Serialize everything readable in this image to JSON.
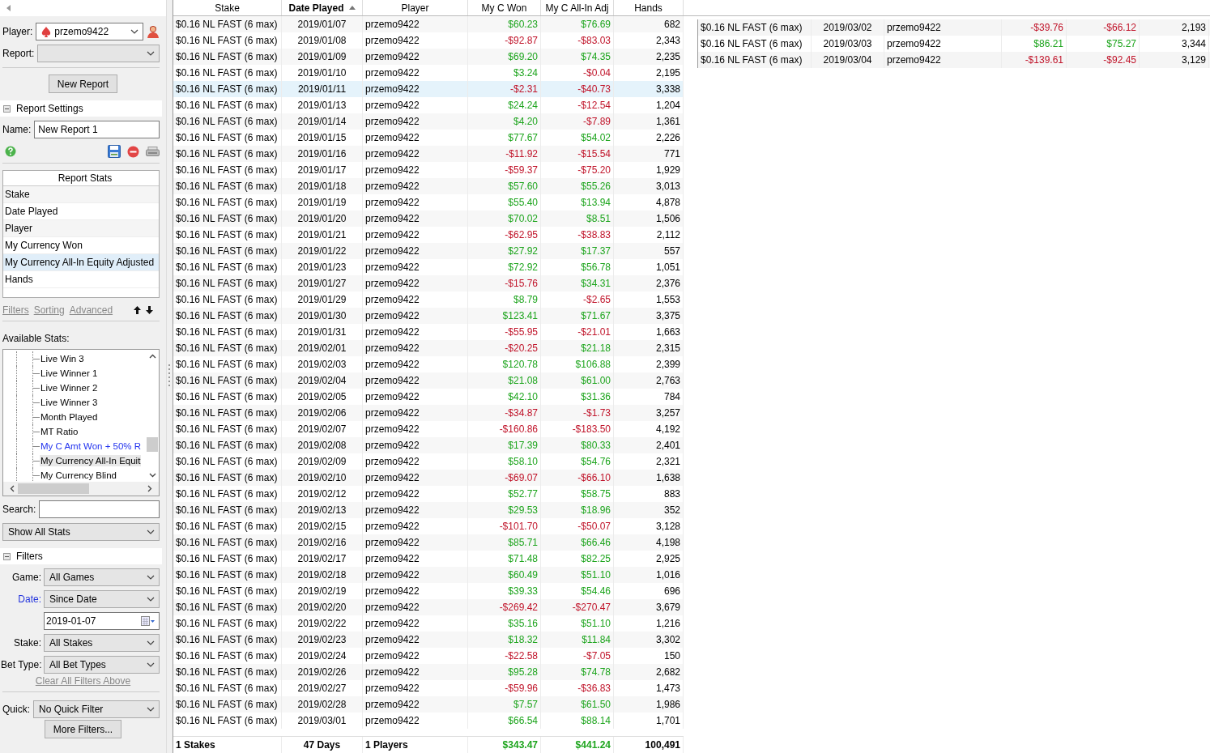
{
  "sidebar": {
    "player": {
      "label": "Player:",
      "value": "przemo9422"
    },
    "report": {
      "label": "Report:"
    },
    "new_report_button": "New Report",
    "report_settings": {
      "title": "Report Settings",
      "expanded": true,
      "name_label": "Name:",
      "name_value": "New Report 1"
    },
    "report_stats": {
      "header": "Report Stats",
      "items": [
        {
          "label": "Stake",
          "selected": false
        },
        {
          "label": "Date Played",
          "selected": false
        },
        {
          "label": "Player",
          "selected": false
        },
        {
          "label": "My Currency Won",
          "selected": false
        },
        {
          "label": "My Currency All-In Equity Adjusted",
          "selected": true
        },
        {
          "label": "Hands",
          "selected": false
        }
      ]
    },
    "links": [
      "Filters",
      "Sorting",
      "Advanced"
    ],
    "available_stats": {
      "label": "Available Stats:",
      "items": [
        {
          "label": "Live Win 3",
          "custom": false,
          "selected": false
        },
        {
          "label": "Live Winner 1",
          "custom": false,
          "selected": false
        },
        {
          "label": "Live Winner 2",
          "custom": false,
          "selected": false
        },
        {
          "label": "Live Winner 3",
          "custom": false,
          "selected": false
        },
        {
          "label": "Month Played",
          "custom": false,
          "selected": false
        },
        {
          "label": "MT Ratio",
          "custom": false,
          "selected": false
        },
        {
          "label": "My C Amt Won + 50% R",
          "custom": true,
          "selected": false
        },
        {
          "label": "My Currency All-In Equit",
          "custom": false,
          "selected": true
        },
        {
          "label": "My Currency Blind",
          "custom": false,
          "selected": false
        }
      ]
    },
    "search": {
      "label": "Search:"
    },
    "stat_filter": "Show All Stats",
    "filters": {
      "title": "Filters",
      "expanded": true,
      "fields": [
        {
          "kind": "select",
          "label": "Game:",
          "value": "All Games",
          "active": false
        },
        {
          "kind": "select",
          "label": "Date:",
          "value": "Since Date",
          "active": true
        },
        {
          "kind": "date",
          "value": "2019-01-07"
        },
        {
          "kind": "select",
          "label": "Stake:",
          "value": "All Stakes",
          "active": false
        },
        {
          "kind": "select",
          "label": "Bet Type:",
          "value": "All Bet Types",
          "active": false
        }
      ],
      "clear_link": "Clear All Filters Above",
      "quick": {
        "label": "Quick:",
        "value": "No Quick Filter"
      },
      "more_button": "More Filters..."
    }
  },
  "table": {
    "columns": [
      {
        "label": "Stake",
        "sorted": false
      },
      {
        "label": "Date Played",
        "sorted": true
      },
      {
        "label": "Player",
        "sorted": false
      },
      {
        "label": "My C Won",
        "sorted": false
      },
      {
        "label": "My C All-In Adj",
        "sorted": false
      },
      {
        "label": "Hands",
        "sorted": false
      }
    ],
    "rows": [
      {
        "stake": "$0.16 NL FAST (6 max)",
        "date": "2019/01/07",
        "player": "przemo9422",
        "won": "$60.23",
        "won_neg": false,
        "adj": "$76.69",
        "adj_neg": false,
        "hands": "682",
        "selected": false
      },
      {
        "stake": "$0.16 NL FAST (6 max)",
        "date": "2019/01/08",
        "player": "przemo9422",
        "won": "-$92.87",
        "won_neg": true,
        "adj": "-$83.03",
        "adj_neg": true,
        "hands": "2,343",
        "selected": false
      },
      {
        "stake": "$0.16 NL FAST (6 max)",
        "date": "2019/01/09",
        "player": "przemo9422",
        "won": "$69.20",
        "won_neg": false,
        "adj": "$74.35",
        "adj_neg": false,
        "hands": "2,235",
        "selected": false
      },
      {
        "stake": "$0.16 NL FAST (6 max)",
        "date": "2019/01/10",
        "player": "przemo9422",
        "won": "$3.24",
        "won_neg": false,
        "adj": "-$0.04",
        "adj_neg": true,
        "hands": "2,195",
        "selected": false
      },
      {
        "stake": "$0.16 NL FAST (6 max)",
        "date": "2019/01/11",
        "player": "przemo9422",
        "won": "-$2.31",
        "won_neg": true,
        "adj": "-$40.73",
        "adj_neg": true,
        "hands": "3,338",
        "selected": true
      },
      {
        "stake": "$0.16 NL FAST (6 max)",
        "date": "2019/01/13",
        "player": "przemo9422",
        "won": "$24.24",
        "won_neg": false,
        "adj": "-$12.54",
        "adj_neg": true,
        "hands": "1,204",
        "selected": false
      },
      {
        "stake": "$0.16 NL FAST (6 max)",
        "date": "2019/01/14",
        "player": "przemo9422",
        "won": "$4.20",
        "won_neg": false,
        "adj": "-$7.89",
        "adj_neg": true,
        "hands": "1,361",
        "selected": false
      },
      {
        "stake": "$0.16 NL FAST (6 max)",
        "date": "2019/01/15",
        "player": "przemo9422",
        "won": "$77.67",
        "won_neg": false,
        "adj": "$54.02",
        "adj_neg": false,
        "hands": "2,226",
        "selected": false
      },
      {
        "stake": "$0.16 NL FAST (6 max)",
        "date": "2019/01/16",
        "player": "przemo9422",
        "won": "-$11.92",
        "won_neg": true,
        "adj": "-$15.54",
        "adj_neg": true,
        "hands": "771",
        "selected": false
      },
      {
        "stake": "$0.16 NL FAST (6 max)",
        "date": "2019/01/17",
        "player": "przemo9422",
        "won": "-$59.37",
        "won_neg": true,
        "adj": "-$75.20",
        "adj_neg": true,
        "hands": "1,929",
        "selected": false
      },
      {
        "stake": "$0.16 NL FAST (6 max)",
        "date": "2019/01/18",
        "player": "przemo9422",
        "won": "$57.60",
        "won_neg": false,
        "adj": "$55.26",
        "adj_neg": false,
        "hands": "3,013",
        "selected": false
      },
      {
        "stake": "$0.16 NL FAST (6 max)",
        "date": "2019/01/19",
        "player": "przemo9422",
        "won": "$55.40",
        "won_neg": false,
        "adj": "$13.94",
        "adj_neg": false,
        "hands": "4,878",
        "selected": false
      },
      {
        "stake": "$0.16 NL FAST (6 max)",
        "date": "2019/01/20",
        "player": "przemo9422",
        "won": "$70.02",
        "won_neg": false,
        "adj": "$8.51",
        "adj_neg": false,
        "hands": "1,506",
        "selected": false
      },
      {
        "stake": "$0.16 NL FAST (6 max)",
        "date": "2019/01/21",
        "player": "przemo9422",
        "won": "-$62.95",
        "won_neg": true,
        "adj": "-$38.83",
        "adj_neg": true,
        "hands": "2,112",
        "selected": false
      },
      {
        "stake": "$0.16 NL FAST (6 max)",
        "date": "2019/01/22",
        "player": "przemo9422",
        "won": "$27.92",
        "won_neg": false,
        "adj": "$17.37",
        "adj_neg": false,
        "hands": "557",
        "selected": false
      },
      {
        "stake": "$0.16 NL FAST (6 max)",
        "date": "2019/01/23",
        "player": "przemo9422",
        "won": "$72.92",
        "won_neg": false,
        "adj": "$56.78",
        "adj_neg": false,
        "hands": "1,051",
        "selected": false
      },
      {
        "stake": "$0.16 NL FAST (6 max)",
        "date": "2019/01/27",
        "player": "przemo9422",
        "won": "-$15.76",
        "won_neg": true,
        "adj": "$34.31",
        "adj_neg": false,
        "hands": "2,376",
        "selected": false
      },
      {
        "stake": "$0.16 NL FAST (6 max)",
        "date": "2019/01/29",
        "player": "przemo9422",
        "won": "$8.79",
        "won_neg": false,
        "adj": "-$2.65",
        "adj_neg": true,
        "hands": "1,553",
        "selected": false
      },
      {
        "stake": "$0.16 NL FAST (6 max)",
        "date": "2019/01/30",
        "player": "przemo9422",
        "won": "$123.41",
        "won_neg": false,
        "adj": "$71.67",
        "adj_neg": false,
        "hands": "3,375",
        "selected": false
      },
      {
        "stake": "$0.16 NL FAST (6 max)",
        "date": "2019/01/31",
        "player": "przemo9422",
        "won": "-$55.95",
        "won_neg": true,
        "adj": "-$21.01",
        "adj_neg": true,
        "hands": "1,663",
        "selected": false
      },
      {
        "stake": "$0.16 NL FAST (6 max)",
        "date": "2019/02/01",
        "player": "przemo9422",
        "won": "-$20.25",
        "won_neg": true,
        "adj": "$21.18",
        "adj_neg": false,
        "hands": "2,315",
        "selected": false
      },
      {
        "stake": "$0.16 NL FAST (6 max)",
        "date": "2019/02/03",
        "player": "przemo9422",
        "won": "$120.78",
        "won_neg": false,
        "adj": "$106.88",
        "adj_neg": false,
        "hands": "2,399",
        "selected": false
      },
      {
        "stake": "$0.16 NL FAST (6 max)",
        "date": "2019/02/04",
        "player": "przemo9422",
        "won": "$21.08",
        "won_neg": false,
        "adj": "$61.00",
        "adj_neg": false,
        "hands": "2,763",
        "selected": false
      },
      {
        "stake": "$0.16 NL FAST (6 max)",
        "date": "2019/02/05",
        "player": "przemo9422",
        "won": "$42.10",
        "won_neg": false,
        "adj": "$31.36",
        "adj_neg": false,
        "hands": "784",
        "selected": false
      },
      {
        "stake": "$0.16 NL FAST (6 max)",
        "date": "2019/02/06",
        "player": "przemo9422",
        "won": "-$34.87",
        "won_neg": true,
        "adj": "-$1.73",
        "adj_neg": true,
        "hands": "3,257",
        "selected": false
      },
      {
        "stake": "$0.16 NL FAST (6 max)",
        "date": "2019/02/07",
        "player": "przemo9422",
        "won": "-$160.86",
        "won_neg": true,
        "adj": "-$183.50",
        "adj_neg": true,
        "hands": "4,192",
        "selected": false
      },
      {
        "stake": "$0.16 NL FAST (6 max)",
        "date": "2019/02/08",
        "player": "przemo9422",
        "won": "$17.39",
        "won_neg": false,
        "adj": "$80.33",
        "adj_neg": false,
        "hands": "2,401",
        "selected": false
      },
      {
        "stake": "$0.16 NL FAST (6 max)",
        "date": "2019/02/09",
        "player": "przemo9422",
        "won": "$58.10",
        "won_neg": false,
        "adj": "$54.76",
        "adj_neg": false,
        "hands": "2,321",
        "selected": false
      },
      {
        "stake": "$0.16 NL FAST (6 max)",
        "date": "2019/02/10",
        "player": "przemo9422",
        "won": "-$69.07",
        "won_neg": true,
        "adj": "-$66.10",
        "adj_neg": true,
        "hands": "1,638",
        "selected": false
      },
      {
        "stake": "$0.16 NL FAST (6 max)",
        "date": "2019/02/12",
        "player": "przemo9422",
        "won": "$52.77",
        "won_neg": false,
        "adj": "$58.75",
        "adj_neg": false,
        "hands": "883",
        "selected": false
      },
      {
        "stake": "$0.16 NL FAST (6 max)",
        "date": "2019/02/13",
        "player": "przemo9422",
        "won": "$29.53",
        "won_neg": false,
        "adj": "$18.96",
        "adj_neg": false,
        "hands": "352",
        "selected": false
      },
      {
        "stake": "$0.16 NL FAST (6 max)",
        "date": "2019/02/15",
        "player": "przemo9422",
        "won": "-$101.70",
        "won_neg": true,
        "adj": "-$50.07",
        "adj_neg": true,
        "hands": "3,128",
        "selected": false
      },
      {
        "stake": "$0.16 NL FAST (6 max)",
        "date": "2019/02/16",
        "player": "przemo9422",
        "won": "$85.71",
        "won_neg": false,
        "adj": "$66.46",
        "adj_neg": false,
        "hands": "4,198",
        "selected": false
      },
      {
        "stake": "$0.16 NL FAST (6 max)",
        "date": "2019/02/17",
        "player": "przemo9422",
        "won": "$71.48",
        "won_neg": false,
        "adj": "$82.25",
        "adj_neg": false,
        "hands": "2,925",
        "selected": false
      },
      {
        "stake": "$0.16 NL FAST (6 max)",
        "date": "2019/02/18",
        "player": "przemo9422",
        "won": "$60.49",
        "won_neg": false,
        "adj": "$51.10",
        "adj_neg": false,
        "hands": "1,016",
        "selected": false
      },
      {
        "stake": "$0.16 NL FAST (6 max)",
        "date": "2019/02/19",
        "player": "przemo9422",
        "won": "$39.33",
        "won_neg": false,
        "adj": "$54.46",
        "adj_neg": false,
        "hands": "696",
        "selected": false
      },
      {
        "stake": "$0.16 NL FAST (6 max)",
        "date": "2019/02/20",
        "player": "przemo9422",
        "won": "-$269.42",
        "won_neg": true,
        "adj": "-$270.47",
        "adj_neg": true,
        "hands": "3,679",
        "selected": false
      },
      {
        "stake": "$0.16 NL FAST (6 max)",
        "date": "2019/02/22",
        "player": "przemo9422",
        "won": "$35.16",
        "won_neg": false,
        "adj": "$51.10",
        "adj_neg": false,
        "hands": "1,216",
        "selected": false
      },
      {
        "stake": "$0.16 NL FAST (6 max)",
        "date": "2019/02/23",
        "player": "przemo9422",
        "won": "$18.32",
        "won_neg": false,
        "adj": "$11.84",
        "adj_neg": false,
        "hands": "3,302",
        "selected": false
      },
      {
        "stake": "$0.16 NL FAST (6 max)",
        "date": "2019/02/24",
        "player": "przemo9422",
        "won": "-$22.58",
        "won_neg": true,
        "adj": "-$7.05",
        "adj_neg": true,
        "hands": "150",
        "selected": false
      },
      {
        "stake": "$0.16 NL FAST (6 max)",
        "date": "2019/02/26",
        "player": "przemo9422",
        "won": "$95.28",
        "won_neg": false,
        "adj": "$74.78",
        "adj_neg": false,
        "hands": "2,682",
        "selected": false
      },
      {
        "stake": "$0.16 NL FAST (6 max)",
        "date": "2019/02/27",
        "player": "przemo9422",
        "won": "-$59.96",
        "won_neg": true,
        "adj": "-$36.83",
        "adj_neg": true,
        "hands": "1,473",
        "selected": false
      },
      {
        "stake": "$0.16 NL FAST (6 max)",
        "date": "2019/02/28",
        "player": "przemo9422",
        "won": "$7.57",
        "won_neg": false,
        "adj": "$61.50",
        "adj_neg": false,
        "hands": "1,986",
        "selected": false
      },
      {
        "stake": "$0.16 NL FAST (6 max)",
        "date": "2019/03/01",
        "player": "przemo9422",
        "won": "$66.54",
        "won_neg": false,
        "adj": "$88.14",
        "adj_neg": false,
        "hands": "1,701",
        "selected": false
      }
    ],
    "totals": {
      "stake": "1 Stakes",
      "date": "47 Days",
      "player": "1 Players",
      "won": "$343.47",
      "won_neg": false,
      "adj": "$441.24",
      "adj_neg": false,
      "hands": "100,491"
    }
  },
  "side_table": {
    "rows": [
      {
        "stake": "$0.16 NL FAST (6 max)",
        "date": "2019/03/02",
        "player": "przemo9422",
        "won": "-$39.76",
        "won_neg": true,
        "adj": "-$66.12",
        "adj_neg": true,
        "hands": "2,193"
      },
      {
        "stake": "$0.16 NL FAST (6 max)",
        "date": "2019/03/03",
        "player": "przemo9422",
        "won": "$86.21",
        "won_neg": false,
        "adj": "$75.27",
        "adj_neg": false,
        "hands": "3,344"
      },
      {
        "stake": "$0.16 NL FAST (6 max)",
        "date": "2019/03/04",
        "player": "przemo9422",
        "won": "-$139.61",
        "won_neg": true,
        "adj": "-$92.45",
        "adj_neg": true,
        "hands": "3,129"
      }
    ]
  }
}
